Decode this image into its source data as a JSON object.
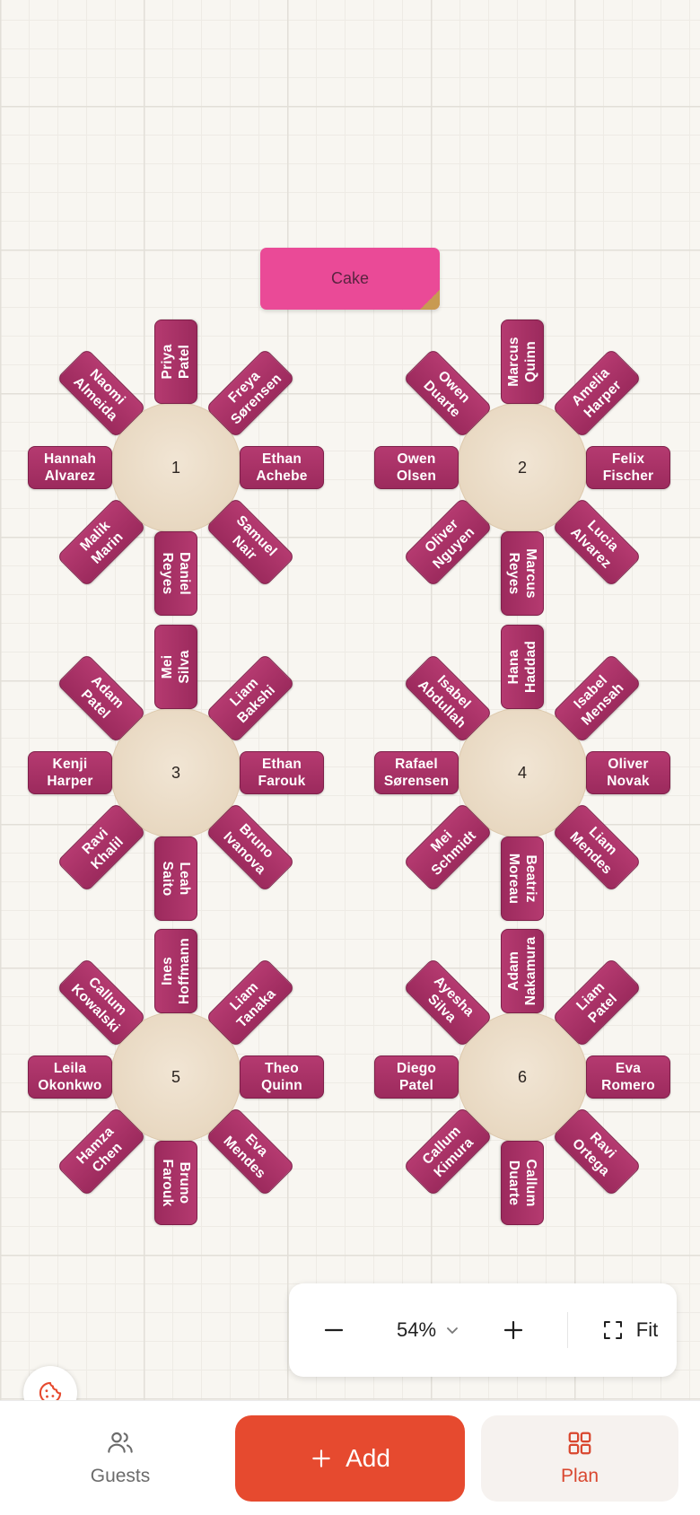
{
  "cake": {
    "label": "Cake"
  },
  "tables": [
    {
      "number": "1",
      "seats": [
        [
          "Priya",
          "Patel"
        ],
        [
          "Freya",
          "Sørensen"
        ],
        [
          "Ethan",
          "Achebe"
        ],
        [
          "Samuel",
          "Nair"
        ],
        [
          "Daniel",
          "Reyes"
        ],
        [
          "Malik",
          "Marin"
        ],
        [
          "Hannah",
          "Alvarez"
        ],
        [
          "Naomi",
          "Almeida"
        ]
      ]
    },
    {
      "number": "2",
      "seats": [
        [
          "Marcus",
          "Quinn"
        ],
        [
          "Amelia",
          "Harper"
        ],
        [
          "Felix",
          "Fischer"
        ],
        [
          "Lucia",
          "Alvarez"
        ],
        [
          "Marcus",
          "Reyes"
        ],
        [
          "Oliver",
          "Nguyen"
        ],
        [
          "Owen",
          "Olsen"
        ],
        [
          "Owen",
          "Duarte"
        ]
      ]
    },
    {
      "number": "3",
      "seats": [
        [
          "Mei",
          "Silva"
        ],
        [
          "Liam",
          "Bakshi"
        ],
        [
          "Ethan",
          "Farouk"
        ],
        [
          "Bruno",
          "Ivanova"
        ],
        [
          "Leah",
          "Saito"
        ],
        [
          "Ravi",
          "Khalil"
        ],
        [
          "Kenji",
          "Harper"
        ],
        [
          "Adam",
          "Patel"
        ]
      ]
    },
    {
      "number": "4",
      "seats": [
        [
          "Hana",
          "Haddad"
        ],
        [
          "Isabel",
          "Mensah"
        ],
        [
          "Oliver",
          "Novak"
        ],
        [
          "Liam",
          "Mendes"
        ],
        [
          "Beatriz",
          "Moreau"
        ],
        [
          "Mei",
          "Schmidt"
        ],
        [
          "Rafael",
          "Sørensen"
        ],
        [
          "Isabel",
          "Abdullah"
        ]
      ]
    },
    {
      "number": "5",
      "seats": [
        [
          "Ines",
          "Hoffmann"
        ],
        [
          "Liam",
          "Tanaka"
        ],
        [
          "Theo",
          "Quinn"
        ],
        [
          "Eva",
          "Mendes"
        ],
        [
          "Bruno",
          "Farouk"
        ],
        [
          "Hamza",
          "Chen"
        ],
        [
          "Leila",
          "Okonkwo"
        ],
        [
          "Callum",
          "Kowalski"
        ]
      ]
    },
    {
      "number": "6",
      "seats": [
        [
          "Adam",
          "Nakamura"
        ],
        [
          "Liam",
          "Patel"
        ],
        [
          "Eva",
          "Romero"
        ],
        [
          "Ravi",
          "Ortega"
        ],
        [
          "Callum",
          "Duarte"
        ],
        [
          "Callum",
          "Kimura"
        ],
        [
          "Diego",
          "Patel"
        ],
        [
          "Ayesha",
          "Silva"
        ]
      ]
    }
  ],
  "zoom": {
    "value": "54%",
    "out_icon": "minus-icon",
    "in_icon": "plus-icon",
    "fit_label": "Fit",
    "fit_icon": "fit-screen-icon",
    "dropdown_icon": "chevron-down-icon"
  },
  "cookie": {
    "icon": "cookie-icon"
  },
  "nav": {
    "guests_label": "Guests",
    "guests_icon": "users-icon",
    "add_label": "Add",
    "add_icon": "plus-icon",
    "plan_label": "Plan",
    "plan_icon": "grid-icon"
  },
  "colors": {
    "accent": "#e64a2f",
    "seat": "#a8306a",
    "table": "#ebdcc6",
    "cake": "#ea4a97"
  }
}
